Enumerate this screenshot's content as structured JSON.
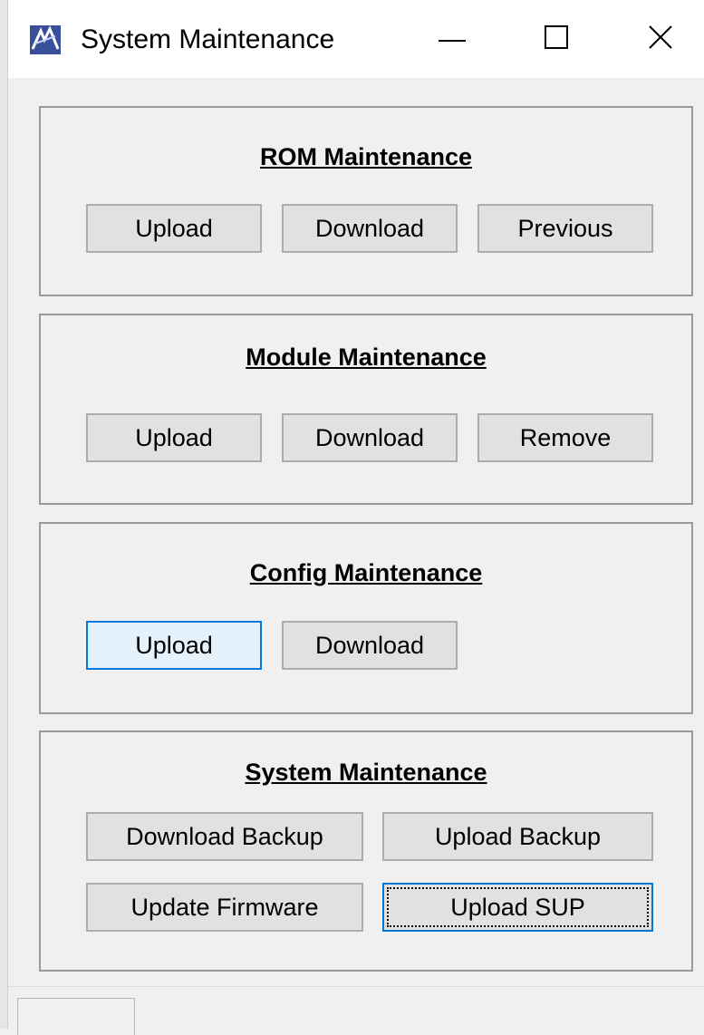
{
  "window": {
    "title": "System Maintenance",
    "icon": "app-logo-icon",
    "controls": {
      "minimize": "minimize-icon",
      "maximize": "maximize-icon",
      "close": "close-icon"
    }
  },
  "groups": {
    "rom": {
      "title": "ROM Maintenance",
      "buttons": {
        "upload": "Upload",
        "download": "Download",
        "previous": "Previous"
      }
    },
    "module": {
      "title": "Module Maintenance",
      "buttons": {
        "upload": "Upload",
        "download": "Download",
        "remove": "Remove"
      }
    },
    "config": {
      "title": "Config Maintenance",
      "buttons": {
        "upload": "Upload",
        "download": "Download"
      }
    },
    "system": {
      "title": "System Maintenance",
      "buttons": {
        "download_backup": "Download Backup",
        "upload_backup": "Upload Backup",
        "update_firmware": "Update Firmware",
        "upload_sup": "Upload SUP"
      }
    }
  },
  "colors": {
    "accent": "#0078d7",
    "button_face": "#e1e1e1",
    "hover_face": "#e5f1fb"
  }
}
